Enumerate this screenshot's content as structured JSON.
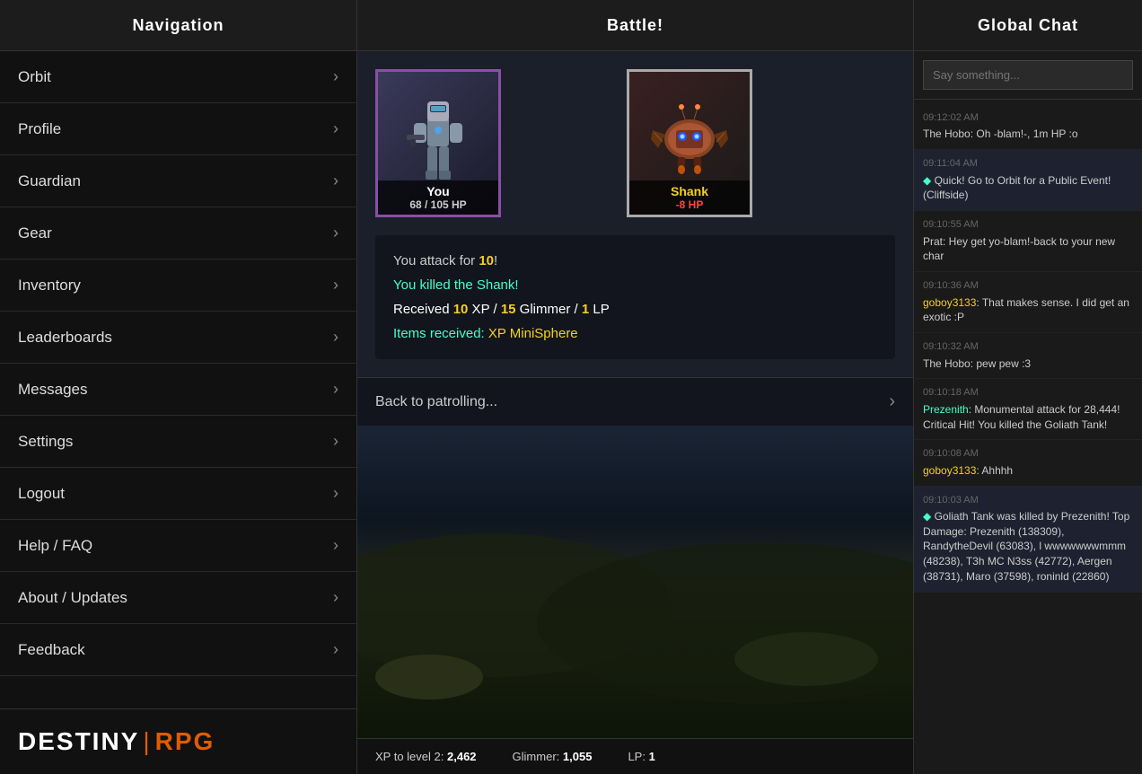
{
  "sidebar": {
    "header": "Navigation",
    "items": [
      {
        "label": "Orbit",
        "id": "orbit"
      },
      {
        "label": "Profile",
        "id": "profile"
      },
      {
        "label": "Guardian",
        "id": "guardian"
      },
      {
        "label": "Gear",
        "id": "gear"
      },
      {
        "label": "Inventory",
        "id": "inventory"
      },
      {
        "label": "Leaderboards",
        "id": "leaderboards"
      },
      {
        "label": "Messages",
        "id": "messages"
      },
      {
        "label": "Settings",
        "id": "settings"
      },
      {
        "label": "Logout",
        "id": "logout"
      },
      {
        "label": "Help / FAQ",
        "id": "help"
      },
      {
        "label": "About / Updates",
        "id": "about"
      },
      {
        "label": "Feedback",
        "id": "feedback"
      }
    ],
    "logo": {
      "destiny": "DESTINY",
      "separator": "|",
      "rpg": "RPG"
    }
  },
  "main": {
    "header": "Battle!",
    "player": {
      "name": "You",
      "hp_current": 68,
      "hp_max": 105,
      "hp_display": "68 / 105 HP"
    },
    "enemy": {
      "name": "Shank",
      "hp_display": "-8 HP"
    },
    "battle_log": {
      "line1_prefix": "You attack for ",
      "line1_damage": "10",
      "line1_suffix": "!",
      "line2": "You killed the Shank!",
      "line3_prefix": "Received ",
      "line3_xp": "10",
      "line3_mid": " XP / ",
      "line3_glimmer": "15",
      "line3_mid2": " Glimmer / ",
      "line3_lp": "1",
      "line3_suffix": " LP",
      "line4_prefix": "Items received: ",
      "line4_item": "XP MiniSphere"
    },
    "back_to_patrolling": "Back to patrolling...",
    "status_bar": {
      "xp_label": "XP to level 2:",
      "xp_value": "2,462",
      "glimmer_label": "Glimmer:",
      "glimmer_value": "1,055",
      "lp_label": "LP:",
      "lp_value": "1"
    }
  },
  "chat": {
    "header": "Global Chat",
    "input_placeholder": "Say something...",
    "messages": [
      {
        "timestamp": "09:12:02 AM",
        "username": "The Hobo",
        "username_class": "username-hobo",
        "text": "Oh -blam!-, 1m HP :o",
        "system": false
      },
      {
        "timestamp": "09:11:04 AM",
        "username": "",
        "text": "Quick! Go to Orbit for a Public Event! (Cliffside)",
        "system": true
      },
      {
        "timestamp": "09:10:55 AM",
        "username": "Prat",
        "username_class": "username-prat",
        "text": "Hey get yo-blam!-back to your new char",
        "system": false
      },
      {
        "timestamp": "09:10:36 AM",
        "username": "goboy3133",
        "username_class": "username-goboy",
        "text": "That makes sense. I did get an exotic :P",
        "system": false
      },
      {
        "timestamp": "09:10:32 AM",
        "username": "The Hobo",
        "username_class": "username-hobo",
        "text": "pew pew :3",
        "system": false
      },
      {
        "timestamp": "09:10:18 AM",
        "username": "Prezenith",
        "username_class": "username-prezenith",
        "text": "Monumental attack for 28,444! Critical Hit! You killed the Goliath Tank!",
        "system": false
      },
      {
        "timestamp": "09:10:08 AM",
        "username": "goboy3133",
        "username_class": "username-goboy",
        "text": "Ahhhh",
        "system": false
      },
      {
        "timestamp": "09:10:03 AM",
        "username": "",
        "text": "Goliath Tank was killed by Prezenith! Top Damage: Prezenith (138309), RandytheDevil (63083), l wwwwwwwmmm (48238), T3h MC N3ss (42772), Aergen (38731), Maro (37598), roninld (22860)",
        "system": true
      }
    ]
  }
}
